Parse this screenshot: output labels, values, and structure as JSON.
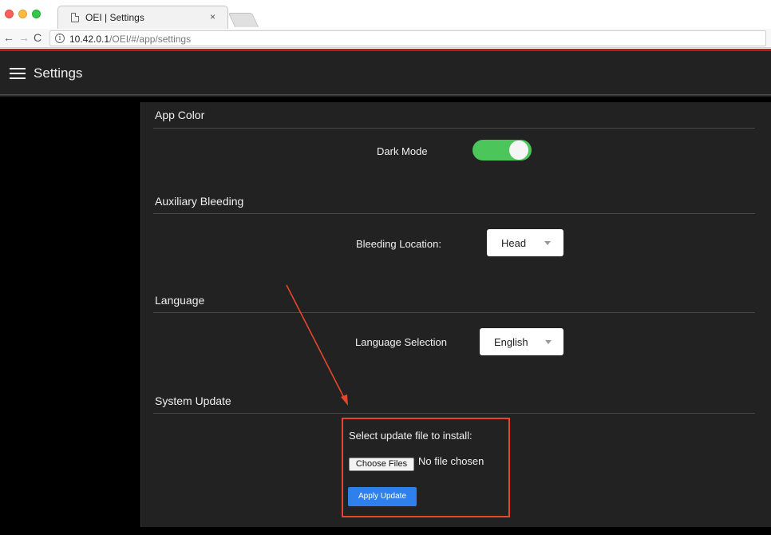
{
  "browser": {
    "tab_title": "OEI | Settings",
    "tab_close": "×",
    "url_host": "10.42.0.1",
    "url_path": "/OEI/#/app/settings",
    "nav": {
      "back": "←",
      "forward": "→",
      "reload": "C"
    },
    "info_glyph": "i"
  },
  "app": {
    "title": "Settings",
    "accent_color": "#b81c1c"
  },
  "sections": {
    "app_color": {
      "title": "App Color",
      "dark_mode_label": "Dark Mode",
      "dark_mode_on": true
    },
    "auxiliary_bleeding": {
      "title": "Auxiliary Bleeding",
      "location_label": "Bleeding Location:",
      "location_value": "Head"
    },
    "language": {
      "title": "Language",
      "selection_label": "Language Selection",
      "selection_value": "English"
    },
    "system_update": {
      "title": "System Update",
      "select_label": "Select update file to install:",
      "choose_button": "Choose Files",
      "no_file_text": "No file chosen",
      "apply_button": "Apply Update"
    }
  },
  "annotation": {
    "highlight_color": "#e8462b"
  },
  "icons": {
    "menu": "hamburger-menu-icon",
    "page": "page-icon",
    "info": "info-icon"
  }
}
